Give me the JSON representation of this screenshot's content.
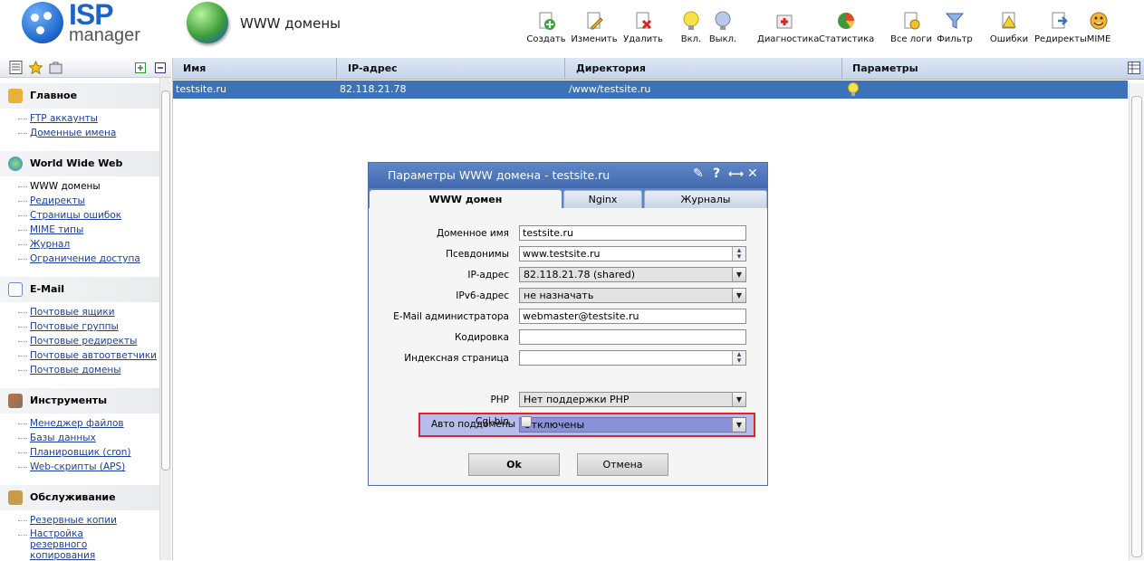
{
  "app": {
    "logo_top": "ISP",
    "logo_bottom": "manager",
    "page_title": "WWW домены"
  },
  "toolbar": [
    {
      "label": "Создать",
      "icon": "create-icon"
    },
    {
      "label": "Изменить",
      "icon": "edit-icon"
    },
    {
      "label": "Удалить",
      "icon": "delete-icon"
    },
    {
      "label": "Вкл.",
      "icon": "bulb-on-icon"
    },
    {
      "label": "Выкл.",
      "icon": "bulb-off-icon"
    },
    {
      "label": "Диагностика",
      "icon": "diagnostics-icon"
    },
    {
      "label": "Статистика",
      "icon": "statistics-icon"
    },
    {
      "label": "Все логи",
      "icon": "logs-icon"
    },
    {
      "label": "Фильтр",
      "icon": "filter-icon"
    },
    {
      "label": "Ошибки",
      "icon": "errors-icon"
    },
    {
      "label": "Редиректы",
      "icon": "redirects-icon"
    },
    {
      "label": "MIME",
      "icon": "mime-icon"
    }
  ],
  "sidebar": {
    "groups": [
      {
        "title": "Главное",
        "icon": "home-icon",
        "color": "#e8b23a",
        "items": [
          "FTP аккаунты",
          "Доменные имена"
        ]
      },
      {
        "title": "World Wide Web",
        "icon": "globe-icon",
        "color": "#3f9f38",
        "items": [
          "WWW домены",
          "Редиректы",
          "Страницы ошибок",
          "MIME типы",
          "Журнал",
          "Ограничение доступа"
        ]
      },
      {
        "title": "E-Mail",
        "icon": "mail-icon",
        "color": "#7aa2d6",
        "items": [
          "Почтовые ящики",
          "Почтовые группы",
          "Почтовые редиректы",
          "Почтовые автоответчики",
          "Почтовые домены"
        ]
      },
      {
        "title": "Инструменты",
        "icon": "tools-icon",
        "color": "#d26a2a",
        "items": [
          "Менеджер файлов",
          "Базы данных",
          "Планировщик (cron)",
          "Web-скрипты (APS)"
        ]
      },
      {
        "title": "Обслуживание",
        "icon": "maintenance-icon",
        "color": "#c99a4a",
        "items": [
          "Резервные копии",
          "Настройка резервного копирования"
        ]
      }
    ]
  },
  "grid": {
    "columns": [
      "Имя",
      "IP-адрес",
      "Директория",
      "Параметры"
    ],
    "rows": [
      {
        "name": "testsite.ru",
        "ip": "82.118.21.78",
        "dir": "/www/testsite.ru",
        "params": "bulb-on-icon"
      }
    ]
  },
  "dialog": {
    "title": "Параметры WWW домена - testsite.ru",
    "tabs": [
      "WWW домен",
      "Nginx",
      "Журналы"
    ],
    "fields": {
      "domain_label": "Доменное имя",
      "domain_value": "testsite.ru",
      "aliases_label": "Псевдонимы",
      "aliases_value": "www.testsite.ru",
      "ip_label": "IP-адрес",
      "ip_value": "82.118.21.78 (shared)",
      "ipv6_label": "IPv6-адрес",
      "ipv6_value": "не назначать",
      "email_label": "E-Mail администратора",
      "email_value": "webmaster@testsite.ru",
      "charset_label": "Кодировка",
      "charset_value": "",
      "index_label": "Индексная страница",
      "index_value": "",
      "autosub_label": "Авто поддомены",
      "autosub_value": "Отключены",
      "php_label": "PHP",
      "php_value": "Нет поддержки PHP",
      "cgi_label": "Cgi-bin",
      "cgi_checked": false
    },
    "ok_label": "Ok",
    "cancel_label": "Отмена"
  }
}
